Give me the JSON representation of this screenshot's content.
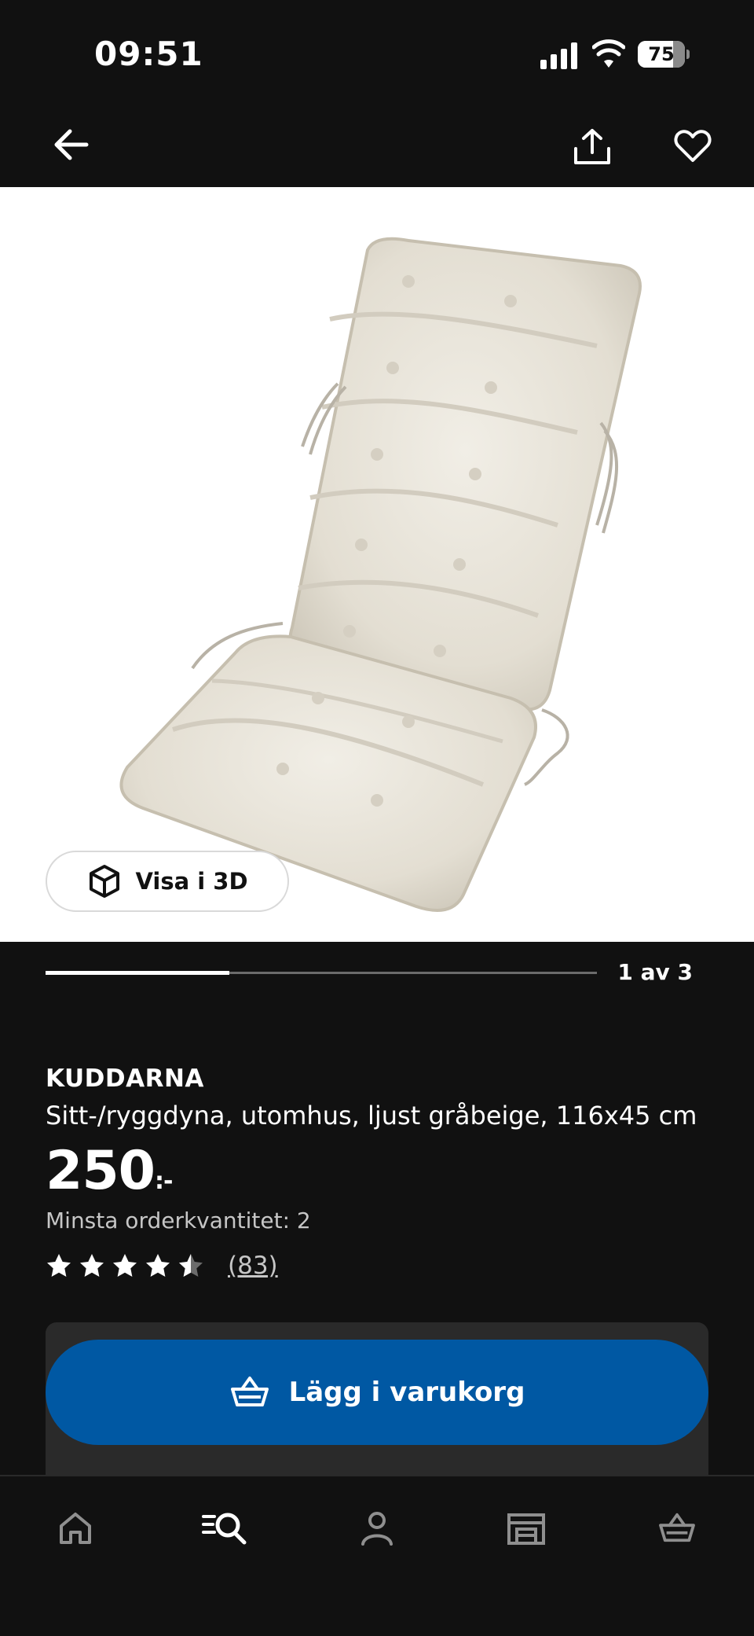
{
  "status_bar": {
    "time": "09:51",
    "battery": "75",
    "battery_level": 0.75,
    "icons": [
      "signal-icon",
      "wifi-icon",
      "battery-icon"
    ]
  },
  "top_nav": {
    "icons": [
      "arrow-left-icon",
      "share-icon",
      "heart-icon"
    ]
  },
  "gallery": {
    "view_3d_label": "Visa i 3D",
    "page_indicator": "1 av 3",
    "progress": 0.333
  },
  "product": {
    "brand": "KUDDARNA",
    "description": "Sitt-/ryggdyna, utomhus, ljust gråbeige, 116x45 cm",
    "price": "250",
    "price_suffix": ":-",
    "min_order": "Minsta orderkvantitet: 2",
    "rating": 4.5,
    "review_count": "(83)"
  },
  "cart": {
    "add_label": "Lägg i varukorg"
  },
  "bottom_nav": {
    "items": [
      "home-icon",
      "search-icon",
      "profile-icon",
      "store-icon",
      "cart-icon"
    ]
  },
  "colors": {
    "background": "#111111",
    "primary_button": "#0058a3",
    "panel": "#2a2a2a"
  }
}
